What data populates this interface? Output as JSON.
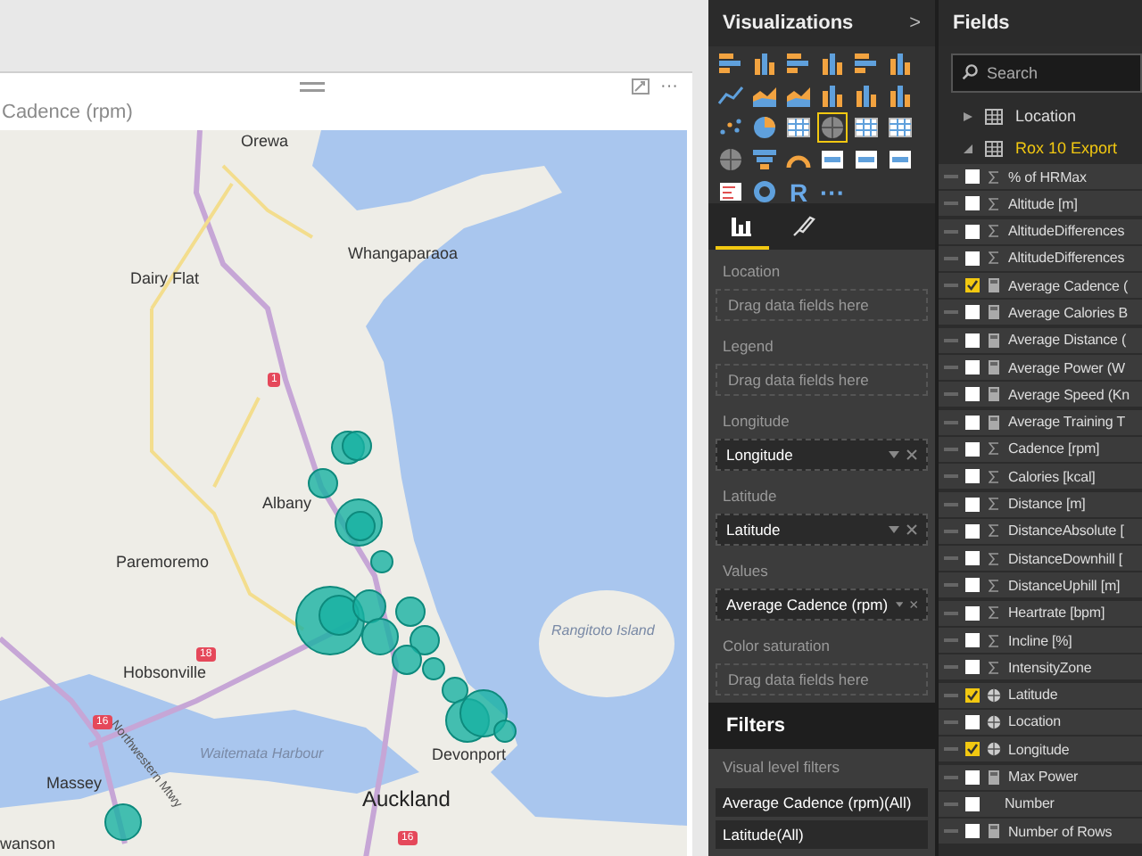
{
  "canvas": {
    "visual": {
      "title": "Cadence (rpm)",
      "more": "···",
      "map_labels": [
        {
          "text": "Orewa",
          "kind": "town"
        },
        {
          "text": "Whangaparaoa",
          "kind": "town"
        },
        {
          "text": "Dairy Flat",
          "kind": "town"
        },
        {
          "text": "Albany",
          "kind": "town"
        },
        {
          "text": "Paremoremo",
          "kind": "town"
        },
        {
          "text": "Rangitoto Island",
          "kind": "water"
        },
        {
          "text": "Hobsonville",
          "kind": "town"
        },
        {
          "text": "Waitemata Harbour",
          "kind": "water"
        },
        {
          "text": "Devonport",
          "kind": "town"
        },
        {
          "text": "Massey",
          "kind": "town"
        },
        {
          "text": "Auckland",
          "kind": "city"
        },
        {
          "text": "wanson",
          "kind": "town"
        },
        {
          "text": "Northwestern Mtwy",
          "kind": "road"
        },
        {
          "text": "1",
          "kind": "shield"
        },
        {
          "text": "18",
          "kind": "shield"
        },
        {
          "text": "16",
          "kind": "shield"
        },
        {
          "text": "16",
          "kind": "shield"
        }
      ]
    }
  },
  "visualizations": {
    "title": "Visualizations",
    "collapse": ">",
    "visual_types": [
      {
        "kind": "bar",
        "selected": false
      },
      {
        "kind": "column",
        "selected": false
      },
      {
        "kind": "bar",
        "selected": false
      },
      {
        "kind": "column",
        "selected": false
      },
      {
        "kind": "bar",
        "selected": false
      },
      {
        "kind": "column",
        "selected": false
      },
      {
        "kind": "line",
        "selected": false
      },
      {
        "kind": "area",
        "selected": false
      },
      {
        "kind": "area",
        "selected": false
      },
      {
        "kind": "column",
        "selected": false
      },
      {
        "kind": "column",
        "selected": false
      },
      {
        "kind": "column",
        "selected": false
      },
      {
        "kind": "scatter",
        "selected": false
      },
      {
        "kind": "pie",
        "selected": false
      },
      {
        "kind": "table",
        "selected": false
      },
      {
        "kind": "map",
        "selected": true
      },
      {
        "kind": "table",
        "selected": false
      },
      {
        "kind": "table",
        "selected": false
      },
      {
        "kind": "map",
        "selected": false
      },
      {
        "kind": "funnel",
        "selected": false
      },
      {
        "kind": "gauge",
        "selected": false
      },
      {
        "kind": "card",
        "selected": false
      },
      {
        "kind": "card",
        "selected": false
      },
      {
        "kind": "card",
        "selected": false
      },
      {
        "kind": "slicer",
        "selected": false
      },
      {
        "kind": "donut",
        "selected": false
      },
      {
        "kind": "text",
        "label": "R",
        "selected": false
      },
      {
        "kind": "more",
        "label": "···",
        "selected": false
      }
    ],
    "tabs": [
      {
        "kind": "fields",
        "selected": true
      },
      {
        "kind": "format",
        "selected": false
      }
    ],
    "wells": [
      {
        "label": "Location",
        "kind": "empty",
        "placeholder": "Drag data fields here"
      },
      {
        "label": "Legend",
        "kind": "empty",
        "placeholder": "Drag data fields here"
      },
      {
        "label": "Longitude",
        "kind": "field",
        "value": "Longitude"
      },
      {
        "label": "Latitude",
        "kind": "field",
        "value": "Latitude"
      },
      {
        "label": "Values",
        "kind": "field",
        "value": "Average Cadence (rpm)"
      },
      {
        "label": "Color saturation",
        "kind": "empty",
        "placeholder": "Drag data fields here"
      }
    ]
  },
  "filters": {
    "title": "Filters",
    "section": "Visual level filters",
    "items": [
      "Average Cadence (rpm)(All)",
      "Latitude(All)"
    ]
  },
  "fields": {
    "title": "Fields",
    "search": {
      "placeholder": "Search"
    },
    "tables": [
      {
        "name": "Location",
        "expanded": false,
        "highlighted": false
      },
      {
        "name": "Rox 10 Export",
        "expanded": true,
        "highlighted": true,
        "children": [
          {
            "name": "% of HRMax",
            "kind": "sum",
            "checked": false
          },
          {
            "name": "Altitude [m]",
            "kind": "sum",
            "checked": false
          },
          {
            "name": "AltitudeDifferences",
            "kind": "sum",
            "checked": false
          },
          {
            "name": "AltitudeDifferences",
            "kind": "sum",
            "checked": false
          },
          {
            "name": "Average Cadence (",
            "kind": "measure",
            "checked": true
          },
          {
            "name": "Average Calories B",
            "kind": "measure",
            "checked": false
          },
          {
            "name": "Average Distance (",
            "kind": "measure",
            "checked": false
          },
          {
            "name": "Average Power (W",
            "kind": "measure",
            "checked": false
          },
          {
            "name": "Average Speed (Kn",
            "kind": "measure",
            "checked": false
          },
          {
            "name": "Average Training T",
            "kind": "measure",
            "checked": false
          },
          {
            "name": "Cadence [rpm]",
            "kind": "sum",
            "checked": false
          },
          {
            "name": "Calories [kcal]",
            "kind": "sum",
            "checked": false
          },
          {
            "name": "Distance [m]",
            "kind": "sum",
            "checked": false
          },
          {
            "name": "DistanceAbsolute [",
            "kind": "sum",
            "checked": false
          },
          {
            "name": "DistanceDownhill [",
            "kind": "sum",
            "checked": false
          },
          {
            "name": "DistanceUphill [m]",
            "kind": "sum",
            "checked": false
          },
          {
            "name": "Heartrate [bpm]",
            "kind": "sum",
            "checked": false
          },
          {
            "name": "Incline [%]",
            "kind": "sum",
            "checked": false
          },
          {
            "name": "IntensityZone",
            "kind": "sum",
            "checked": false
          },
          {
            "name": "Latitude",
            "kind": "geo",
            "checked": true
          },
          {
            "name": "Location",
            "kind": "geo",
            "checked": false
          },
          {
            "name": "Longitude",
            "kind": "geo",
            "checked": true
          },
          {
            "name": "Max Power",
            "kind": "measure",
            "checked": false
          },
          {
            "name": "Number",
            "kind": "plain",
            "checked": false
          },
          {
            "name": "Number of Rows",
            "kind": "measure",
            "checked": false
          }
        ]
      }
    ]
  }
}
